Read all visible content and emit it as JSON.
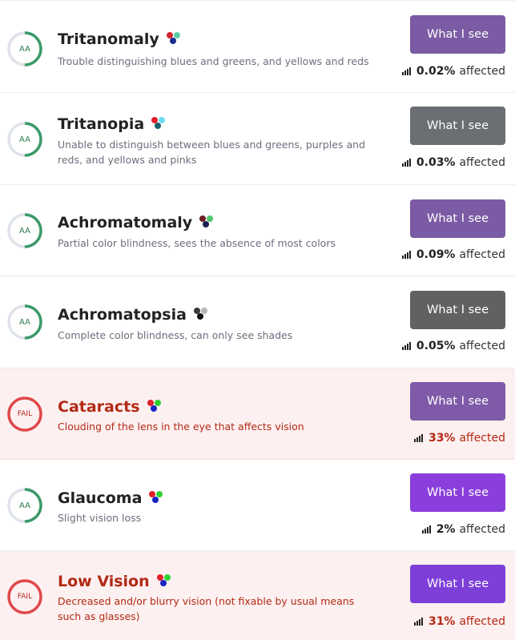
{
  "conditions": [
    {
      "badge": "AA",
      "status": "pass",
      "name": "Tritanomaly",
      "description": "Trouble distinguishing blues and greens, and yellows and reds",
      "button_label": "What I see",
      "button_color": "#7b5ba3",
      "percent": "0.02%",
      "affected_label": "affected",
      "dot_colors": [
        "#d4252a",
        "#5fd0a6",
        "#1b2c8c"
      ]
    },
    {
      "badge": "AA",
      "status": "pass",
      "name": "Tritanopia",
      "description": "Unable to distinguish between blues and greens, purples and reds, and yellows and pinks",
      "button_label": "What I see",
      "button_color": "#6b6e72",
      "percent": "0.03%",
      "affected_label": "affected",
      "dot_colors": [
        "#e1202a",
        "#6ddbee",
        "#1a5f6b"
      ]
    },
    {
      "badge": "AA",
      "status": "pass",
      "name": "Achromatomaly",
      "description": "Partial color blindness, sees the absence of most colors",
      "button_label": "What I see",
      "button_color": "#7b5ba3",
      "percent": "0.09%",
      "affected_label": "affected",
      "dot_colors": [
        "#6b1f22",
        "#53c56d",
        "#1a1f4d"
      ]
    },
    {
      "badge": "AA",
      "status": "pass",
      "name": "Achromatopsia",
      "description": "Complete color blindness, can only see shades",
      "button_label": "What I see",
      "button_color": "#616161",
      "percent": "0.05%",
      "affected_label": "affected",
      "dot_colors": [
        "#3a3a3a",
        "#b5b5b5",
        "#111111"
      ]
    },
    {
      "badge": "FAIL",
      "status": "fail",
      "name": "Cataracts",
      "description": "Clouding of the lens in the eye that affects vision",
      "button_label": "What I see",
      "button_color": "#7f5aa8",
      "percent": "33%",
      "affected_label": "affected",
      "dot_colors": [
        "#e0202a",
        "#2fd035",
        "#1a22c2"
      ]
    },
    {
      "badge": "AA",
      "status": "pass",
      "name": "Glaucoma",
      "description": "Slight vision loss",
      "button_label": "What I see",
      "button_color": "#8a3fdc",
      "percent": "2%",
      "affected_label": "affected",
      "dot_colors": [
        "#e0202a",
        "#2fd035",
        "#1a22c2"
      ]
    },
    {
      "badge": "FAIL",
      "status": "fail",
      "name": "Low Vision",
      "description": "Decreased and/or blurry vision (not fixable by usual means such as glasses)",
      "button_label": "What I see",
      "button_color": "#7d3fd8",
      "percent": "31%",
      "affected_label": "affected",
      "dot_colors": [
        "#e0202a",
        "#2fd035",
        "#1a22c2"
      ]
    }
  ]
}
